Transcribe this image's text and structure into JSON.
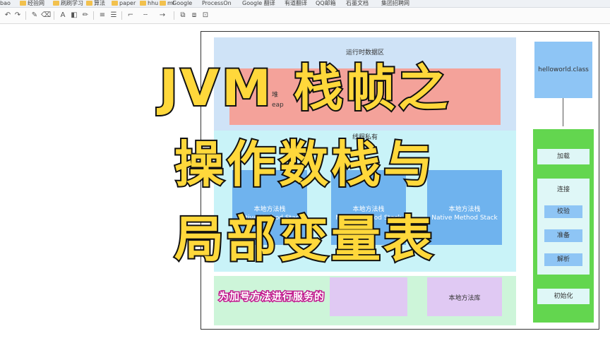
{
  "bookmarks": [
    "bao",
    "经验网",
    "刷刷学习",
    "算法",
    "paper",
    "hhu",
    "ml",
    "Google",
    "ProcessOn",
    "Google 翻译",
    "有道翻译",
    "QQ邮箱",
    "石墨文档",
    "集团招聘网"
  ],
  "diagram": {
    "runtime_area_label": "运行时数据区",
    "heap_label": "堆",
    "heap_sublabel": "eap",
    "thread_private_label": "线程私有",
    "native_stack_label": "本地方法栈",
    "native_stack_en": "Native Method Stack",
    "native_lib_label": "本地方法库",
    "class_file_label": "helloworld.class",
    "loader_steps": [
      "加载",
      "连接",
      "校验",
      "准备",
      "解析",
      "初始化"
    ]
  },
  "overlay": {
    "line1": "JVM 栈帧之",
    "line2": "操作数栈与",
    "line3": "局部变量表"
  },
  "subtitle": "为加号方法进行服务的",
  "colors": {
    "title_fill": "#ffd83b",
    "title_stroke": "#111111",
    "subtitle_stroke": "#c21a8f",
    "runtime_blue": "#cfe3f7",
    "heap_red": "#f4a29a",
    "cyan_area": "#c9f3f8",
    "stack_blue": "#6fb3ee",
    "loader_green": "#63d64f",
    "lib_purple": "#e0c9f3",
    "class_blue": "#8ec5f5"
  }
}
